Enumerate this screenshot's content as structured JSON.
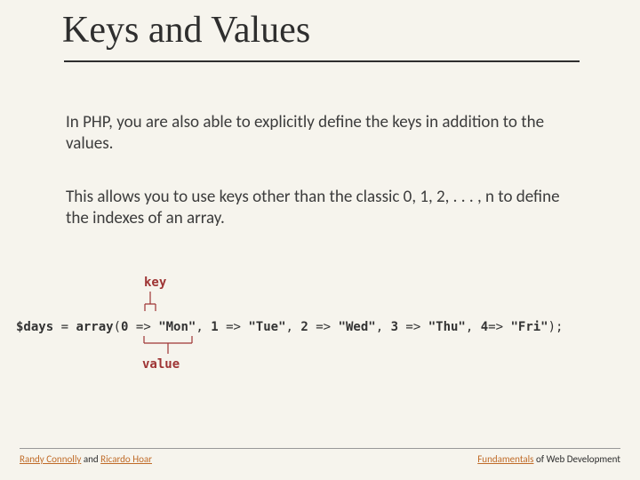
{
  "title": "Keys and Values",
  "para1": "In PHP, you are also able to explicitly define the keys in addition to the values.",
  "para2": "This allows you to use keys other than the classic 0, 1, 2, . . . , n to define the indexes of an array.",
  "key_label": "key",
  "value_label": "value",
  "code": {
    "var": "$days",
    "eq": " = ",
    "fn": "array",
    "open": "(",
    "pairs": [
      {
        "k": "0",
        "arrow": " => ",
        "v": "\"Mon\""
      },
      {
        "k": "1",
        "arrow": " => ",
        "v": "\"Tue\""
      },
      {
        "k": "2",
        "arrow": " => ",
        "v": "\"Wed\""
      },
      {
        "k": "3",
        "arrow": " => ",
        "v": "\"Thu\""
      },
      {
        "k": "4",
        "arrow": "=> ",
        "v": "\"Fri\""
      }
    ],
    "sep": ", ",
    "close": ");"
  },
  "footer": {
    "author1": "Randy Connolly",
    "and": " and ",
    "author2": "Ricardo Hoar",
    "right_linked": "Fundamentals",
    "right_rest": " of Web Development"
  }
}
